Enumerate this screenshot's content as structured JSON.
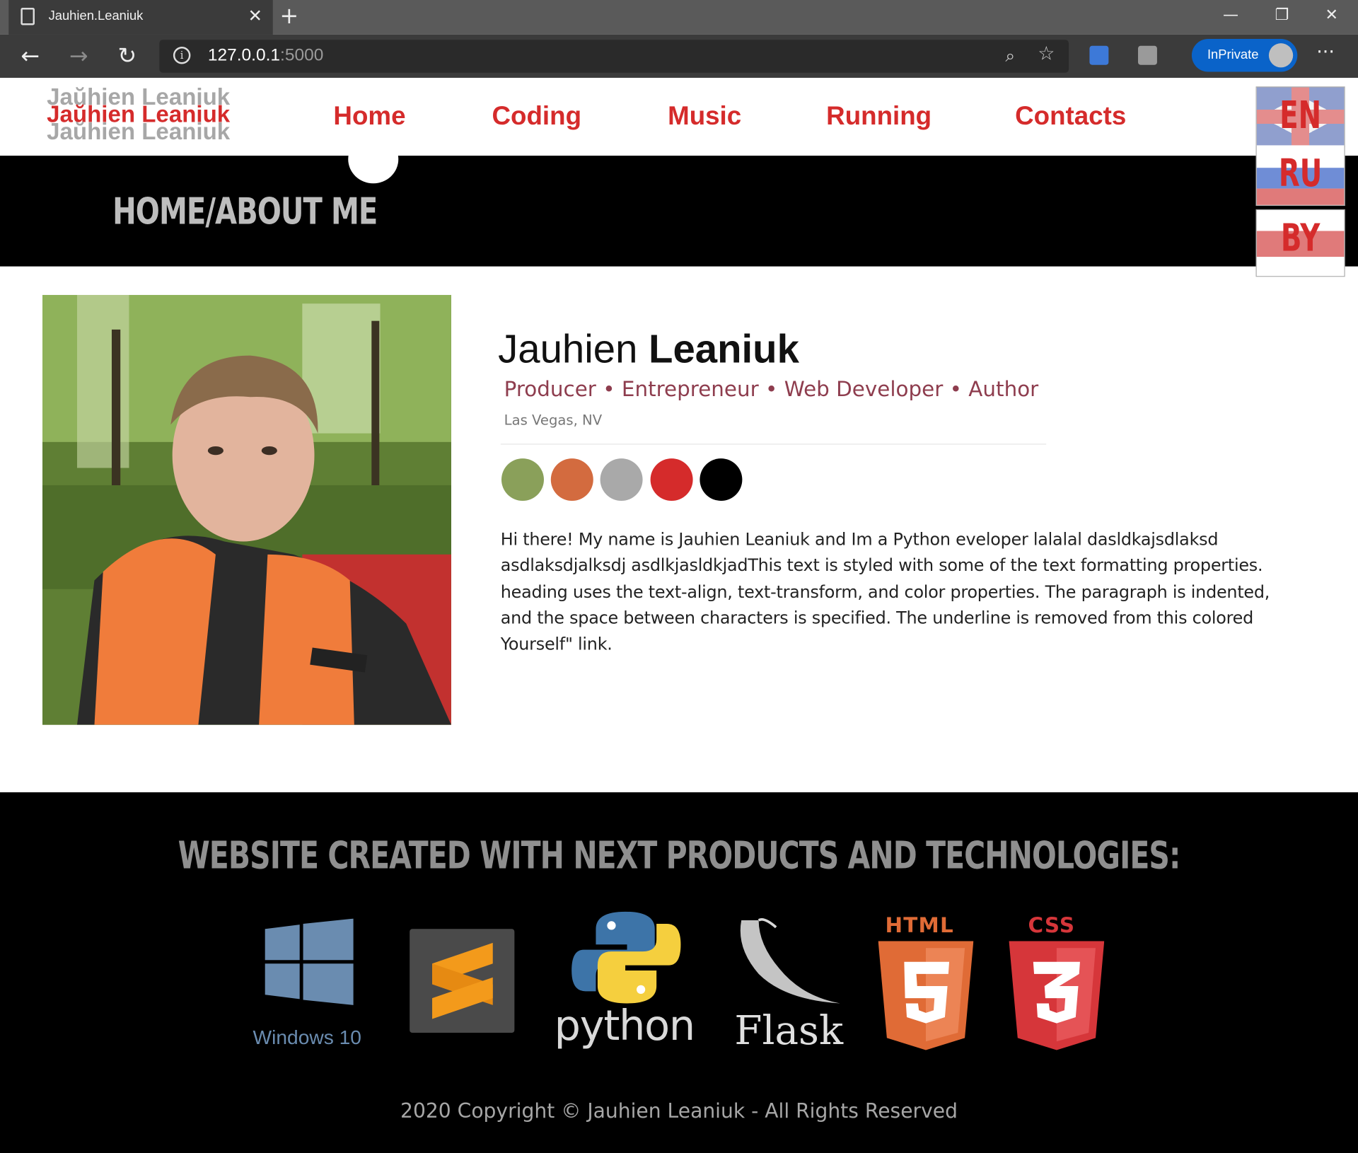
{
  "browser": {
    "tab_title": "Jauhien.Leaniuk",
    "url_host": "127.0.0.1",
    "url_port": ":5000",
    "inprivate_label": "InPrivate",
    "new_tab_glyph": "+",
    "close_glyph": "✕",
    "more_glyph": "···"
  },
  "site": {
    "logo_text": "Jaŭhien Leaniuk",
    "nav": [
      "Home",
      "Coding",
      "Music",
      "Running",
      "Contacts"
    ],
    "page_heading": "HOME/ABOUT ME",
    "languages": [
      "EN",
      "RU",
      "BY"
    ]
  },
  "profile": {
    "first_name": "Jauhien",
    "last_name": "Leaniuk",
    "roles": "Producer • Entrepreneur • Web Developer • Author",
    "location": "Las Vegas, NV",
    "swatches": [
      "#8aa05a",
      "#d36b3f",
      "#a9a9a9",
      "#d52b2b",
      "#000000"
    ],
    "bio": "Hi there! My name is Jauhien Leaniuk and Im a Python eveloper lalalal dasldkajsdlaksd asdlaksdjalksdj asdlkjasldkjadThis text is styled with some of the text formatting properties. heading uses the text-align, text-transform, and color properties. The paragraph is indented, and the space between characters is specified. The underline is removed from this colored Yourself\" link."
  },
  "footer": {
    "title": "WEBSITE CREATED WITH NEXT PRODUCTS AND TECHNOLOGIES:",
    "tech": {
      "windows": "Windows 10",
      "python": "python",
      "flask": "Flask",
      "html": "HTML",
      "css": "CSS"
    },
    "copyright": "2020 Copyright © Jauhien Leaniuk - All Rights Reserved"
  },
  "colors": {
    "accent": "#d52b2b",
    "role_text": "#8e3d4e"
  }
}
